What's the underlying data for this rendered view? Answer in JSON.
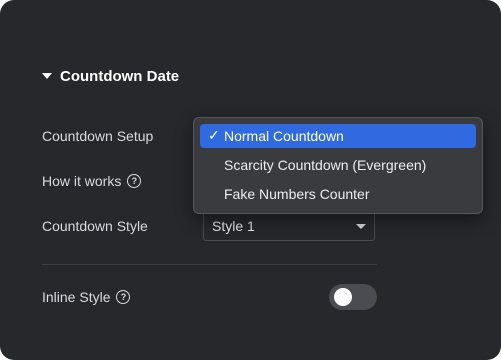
{
  "section": {
    "title": "Countdown Date"
  },
  "fields": {
    "countdown_setup_label": "Countdown Setup",
    "how_it_works_label": "How it works",
    "countdown_style_label": "Countdown Style",
    "countdown_style_value": "Style 1",
    "inline_style_label": "Inline Style",
    "inline_style_on": false
  },
  "dropdown": {
    "items": [
      {
        "label": "Normal Countdown",
        "selected": true
      },
      {
        "label": "Scarcity Countdown (Evergreen)",
        "selected": false
      },
      {
        "label": "Fake Numbers Counter",
        "selected": false
      }
    ],
    "check_glyph": "✓"
  },
  "icons": {
    "help": "question-circle-icon",
    "caret": "caret-down-icon"
  },
  "colors": {
    "panel": "#27282c",
    "selected": "#2f6ae0",
    "menu": "#3a3b3f"
  }
}
